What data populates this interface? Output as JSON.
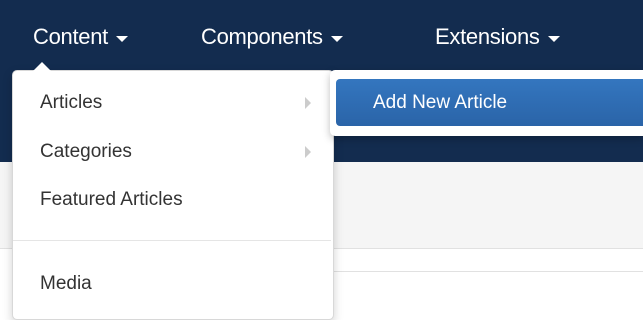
{
  "nav": {
    "items": [
      {
        "label": "Content"
      },
      {
        "label": "Components"
      },
      {
        "label": "Extensions"
      }
    ]
  },
  "dropdown": {
    "items": [
      {
        "label": "Articles",
        "has_submenu": true
      },
      {
        "label": "Categories",
        "has_submenu": true
      },
      {
        "label": "Featured Articles",
        "has_submenu": false
      },
      {
        "label": "Media",
        "has_submenu": false
      }
    ]
  },
  "submenu": {
    "items": [
      {
        "label": "Add New Article",
        "active": true
      }
    ]
  },
  "colors": {
    "navbar": "#132c4f",
    "active_item": "#2b6cb0",
    "text": "#333333"
  },
  "icons": [
    "caret-down-icon",
    "chevron-right-icon"
  ]
}
